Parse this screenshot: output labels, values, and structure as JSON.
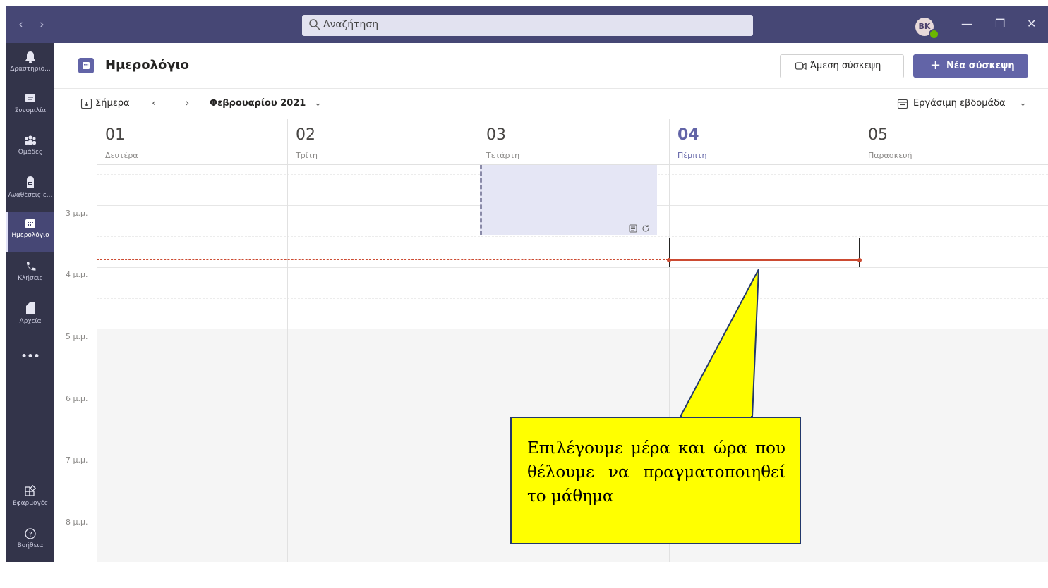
{
  "titlebar": {
    "search_placeholder": "Αναζήτηση",
    "avatar_initials": "BK",
    "presence_color": "#6bb700",
    "bg_color": "#464775"
  },
  "rail": {
    "items": [
      {
        "label": "Δραστηριό...",
        "icon": "bell-icon"
      },
      {
        "label": "Συνομιλία",
        "icon": "chat-icon"
      },
      {
        "label": "Ομάδες",
        "icon": "teams-icon"
      },
      {
        "label": "Αναθέσεις ε...",
        "icon": "assignments-icon"
      },
      {
        "label": "Ημερολόγιο",
        "icon": "calendar-icon"
      },
      {
        "label": "Κλήσεις",
        "icon": "phone-icon"
      },
      {
        "label": "Αρχεία",
        "icon": "file-icon"
      },
      {
        "label": "Εφαρμογές",
        "icon": "apps-icon"
      },
      {
        "label": "Βοήθεια",
        "icon": "help-icon"
      }
    ],
    "more_label": "•••"
  },
  "header": {
    "title": "Ημερολόγιο",
    "meet_now_label": "Άμεση σύσκεψη",
    "new_meeting_label": "Νέα σύσκεψη",
    "accent_color": "#6264a7"
  },
  "toolbar": {
    "today_label": "Σήμερα",
    "month_label": "Φεβρουαρίου 2021",
    "view_label": "Εργάσιμη εβδομάδα"
  },
  "calendar": {
    "days": [
      {
        "num": "01",
        "name": "Δευτέρα"
      },
      {
        "num": "02",
        "name": "Τρίτη"
      },
      {
        "num": "03",
        "name": "Τετάρτη"
      },
      {
        "num": "04",
        "name": "Πέμπτη"
      },
      {
        "num": "05",
        "name": "Παρασκευή"
      }
    ],
    "today_index": 3,
    "hours": [
      "3 μ.μ.",
      "4 μ.μ.",
      "5 μ.μ.",
      "6 μ.μ.",
      "7 μ.μ.",
      "8 μ.μ."
    ]
  },
  "callout": {
    "text": "Επιλέγουμε μέρα και ώρα που θέλουμε να πραγματοποιηθεί το μάθημα"
  }
}
